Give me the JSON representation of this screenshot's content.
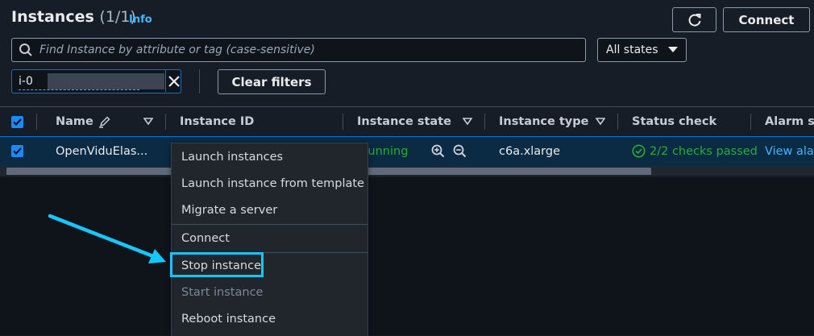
{
  "header": {
    "title": "Instances",
    "count": "(1/1)",
    "info_link": "Info",
    "connect_label": "Connect"
  },
  "search": {
    "placeholder": "Find Instance by attribute or tag (case-sensitive)"
  },
  "state_filter": {
    "selected": "All states"
  },
  "filter_token": {
    "value": "i-0"
  },
  "clear_filters_label": "Clear filters",
  "table": {
    "columns": [
      "Name",
      "Instance ID",
      "Instance state",
      "Instance type",
      "Status check",
      "Alarm st"
    ],
    "row": {
      "name": "OpenViduElas...",
      "state": "Running",
      "type": "c6a.xlarge",
      "status": "2/2 checks passed",
      "alarm": "View alar"
    }
  },
  "context_menu": {
    "items": [
      {
        "label": "Launch instances"
      },
      {
        "label": "Launch instance from template"
      },
      {
        "label": "Migrate a server"
      },
      {
        "label": "Connect"
      },
      {
        "label": "Stop instance"
      },
      {
        "label": "Start instance",
        "disabled": true
      },
      {
        "label": "Reboot instance"
      }
    ]
  },
  "colors": {
    "accent": "#0972d3",
    "success": "#29ad32",
    "link": "#42b4ff",
    "highlight": "#14c8ff",
    "arrow": "#14c8ff"
  },
  "icons": {
    "refresh": "refresh-icon",
    "search": "search-icon",
    "dropdown": "caret-down-icon",
    "clear": "close-icon",
    "edit": "pencil-icon",
    "sort": "sort-caret-icon",
    "zoom_in": "zoom-in-icon",
    "zoom_out": "zoom-out-icon",
    "status_ok": "check-circle-icon"
  }
}
